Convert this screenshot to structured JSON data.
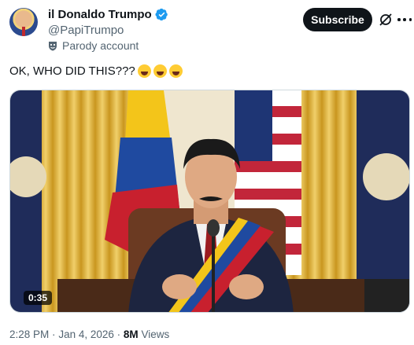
{
  "author": {
    "display_name": "il Donaldo Trumpo",
    "handle": "@PapiTrumpo",
    "account_label": "Parody account",
    "verified_badge_color": "#1d9bf0",
    "avatar_icon": "profile-photo"
  },
  "actions": {
    "subscribe_label": "Subscribe",
    "grok_icon": "grok-icon",
    "more_icon": "more-dots-icon"
  },
  "tweet": {
    "text": "OK, WHO DID THIS???",
    "emojis": [
      "rofl-emoji",
      "rofl-emoji",
      "rofl-emoji"
    ]
  },
  "media": {
    "type": "video",
    "duration": "0:35"
  },
  "meta": {
    "time": "2:28 PM",
    "separator": "·",
    "date": "Jan 4, 2026",
    "views_count": "8M",
    "views_label": "Views"
  }
}
